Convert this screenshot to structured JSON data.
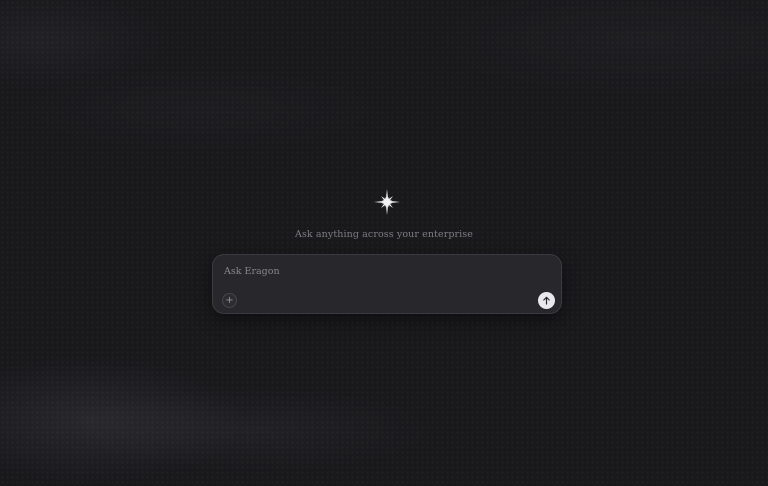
{
  "hero": {
    "icon": "sparkle-icon",
    "subtitle": "Ask anything across your enterprise"
  },
  "chat": {
    "placeholder": "Ask Eragon",
    "value": "",
    "attach_icon": "plus-icon",
    "send_icon": "arrow-up-icon"
  },
  "colors": {
    "background": "#19191c",
    "input_bg": "#28282c",
    "send_button": "#e9e9ec"
  }
}
